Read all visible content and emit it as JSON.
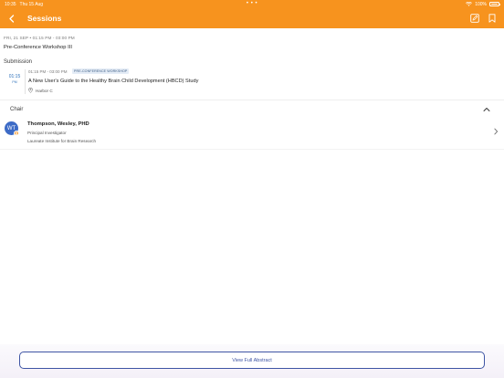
{
  "status_bar": {
    "time": "10:35",
    "date": "Thu 15 Aug",
    "dots": "• • •",
    "battery_text": "100%",
    "battery_level": 1.0
  },
  "nav": {
    "title": "Sessions",
    "icons": {
      "back": "chevron-left-icon",
      "edit": "edit-note-icon",
      "bookmark": "bookmark-icon"
    }
  },
  "session": {
    "date_time": "FRI, 21 SEP • 01:15 PM - 03:00 PM",
    "title": "Pre-Conference Workshop III"
  },
  "submission": {
    "section_label": "Submission",
    "time": "01:15",
    "ampm": "PM",
    "time_range": "01:15 PM - 03:00 PM",
    "tag": "PRE-CONFERENCE WORKSHOP",
    "title": "A New User's Guide to the Healthy Brain Child Development (HBCD) Study",
    "location": "Harbor C"
  },
  "chair": {
    "section_label": "Chair",
    "initials": "WT",
    "name": "Thompson, Wesley, PHD",
    "role": "Principal Investigator",
    "organization": "Laureate Institute for Brain Research"
  },
  "footer": {
    "button_label": "View Full Abstract"
  },
  "colors": {
    "brand_orange": "#f7931e",
    "link_blue": "#3e55a4",
    "avatar_blue": "#3d6bc6",
    "tag_bg": "#e4ecf6"
  }
}
